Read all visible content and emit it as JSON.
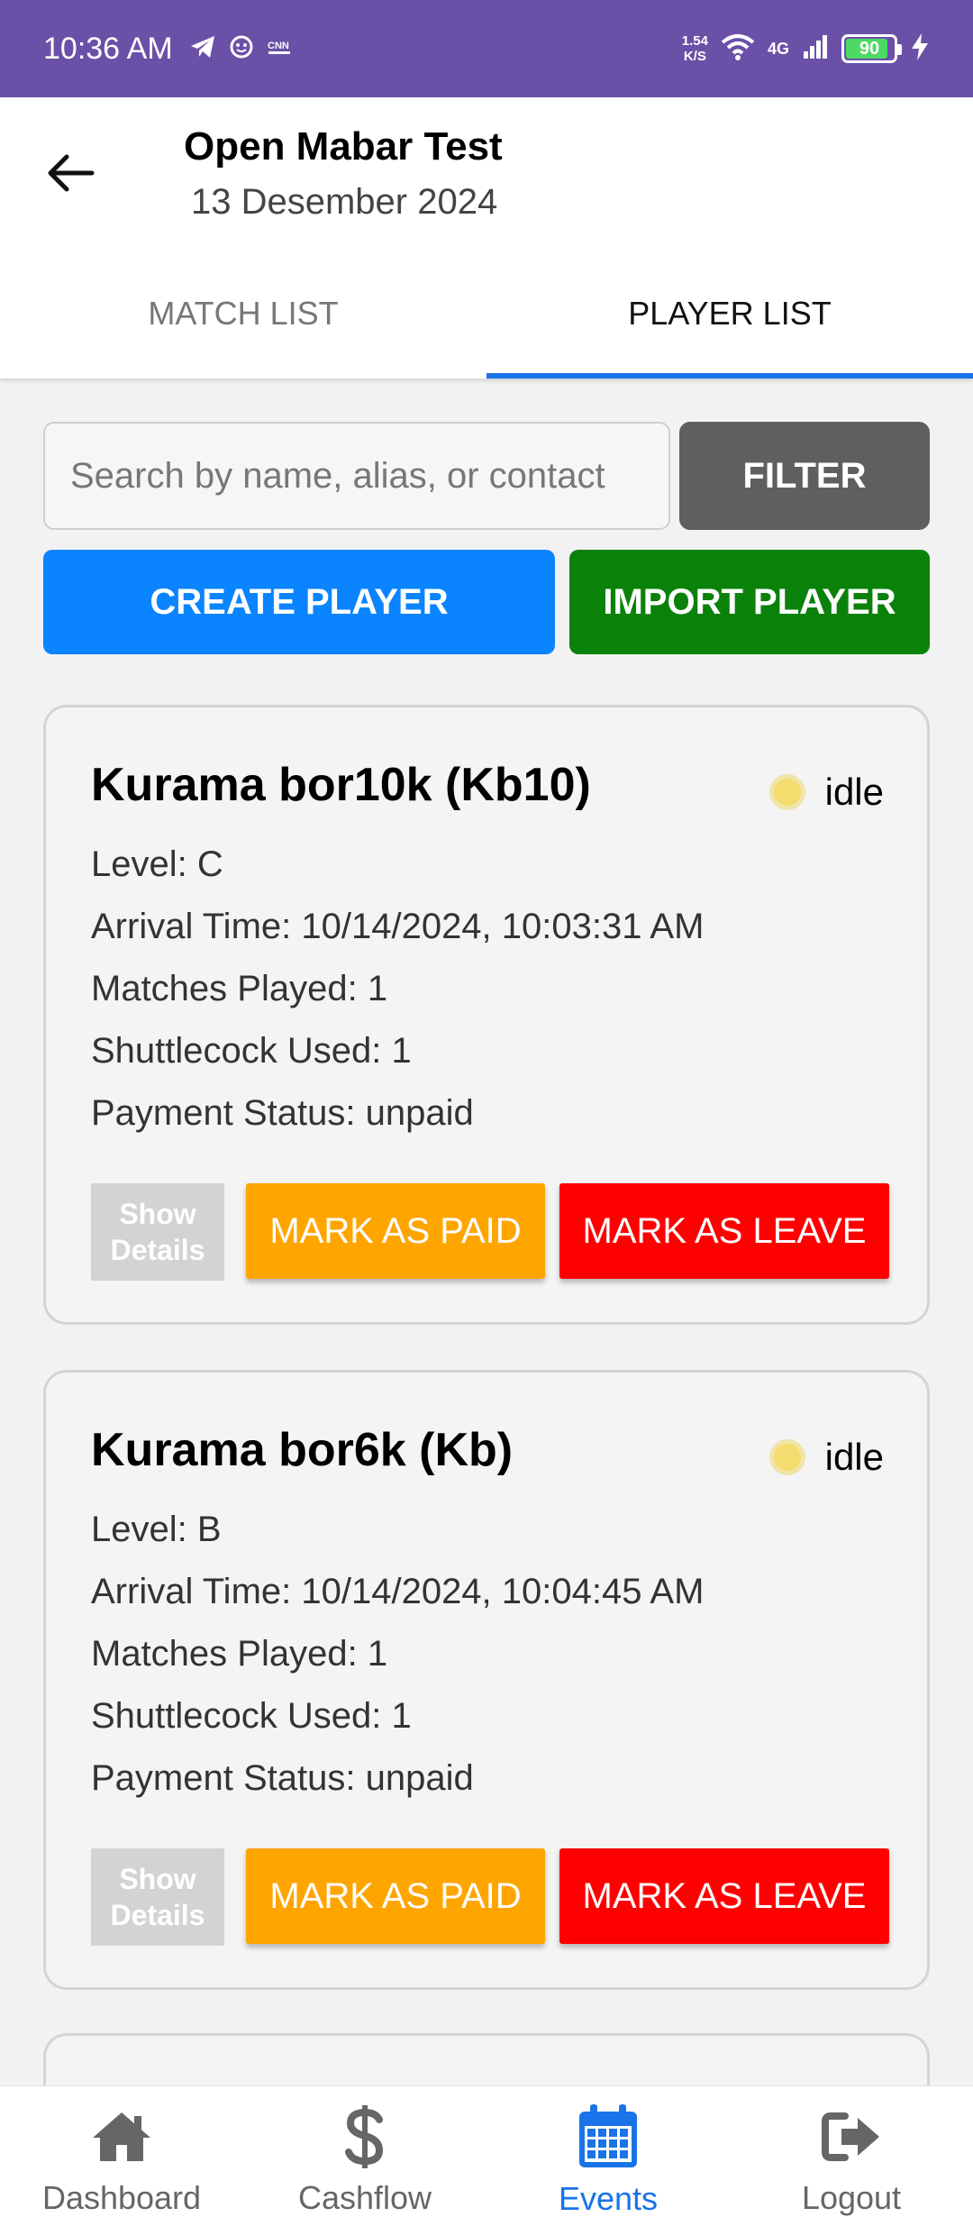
{
  "status_bar": {
    "time": "10:36 AM",
    "net_speed_value": "1.54",
    "net_speed_unit": "K/S",
    "network_type": "4G",
    "battery": "90",
    "battery_level": 0.9
  },
  "header": {
    "title": "Open Mabar Test",
    "subtitle": "13 Desember 2024"
  },
  "tabs": [
    {
      "label": "MATCH LIST",
      "active": false
    },
    {
      "label": "PLAYER LIST",
      "active": true
    }
  ],
  "search": {
    "placeholder": "Search by name, alias, or contact",
    "value": ""
  },
  "buttons": {
    "filter": "FILTER",
    "create_player": "CREATE PLAYER",
    "import_player": "IMPORT PLAYER"
  },
  "players": [
    {
      "name": "Kurama bor10k (Kb10)",
      "status": "idle",
      "level": "Level: C",
      "arrival": "Arrival Time: 10/14/2024, 10:03:31 AM",
      "matches": "Matches Played: 1",
      "shuttlecock": "Shuttlecock Used: 1",
      "payment": "Payment Status: unpaid",
      "show_details_line1": "Show",
      "show_details_line2": "Details",
      "mark_paid": "MARK AS PAID",
      "mark_leave": "MARK AS LEAVE"
    },
    {
      "name": "Kurama bor6k (Kb)",
      "status": "idle",
      "level": "Level: B",
      "arrival": "Arrival Time: 10/14/2024, 10:04:45 AM",
      "matches": "Matches Played: 1",
      "shuttlecock": "Shuttlecock Used: 1",
      "payment": "Payment Status: unpaid",
      "show_details_line1": "Show",
      "show_details_line2": "Details",
      "mark_paid": "MARK AS PAID",
      "mark_leave": "MARK AS LEAVE"
    }
  ],
  "nav": [
    {
      "label": "Dashboard",
      "icon": "home-icon",
      "active": false
    },
    {
      "label": "Cashflow",
      "icon": "dollar-icon",
      "active": false
    },
    {
      "label": "Events",
      "icon": "calendar-icon",
      "active": true
    },
    {
      "label": "Logout",
      "icon": "logout-icon",
      "active": false
    }
  ],
  "colors": {
    "status_bar": "#6a50a7",
    "accent_blue": "#1a73e8",
    "create_button": "#0a84ff",
    "import_button": "#0a820a",
    "filter_button": "#5f5f5f",
    "paid_button": "#ffa500",
    "leave_button": "#ff0000",
    "idle_dot": "#f5dc6e"
  }
}
